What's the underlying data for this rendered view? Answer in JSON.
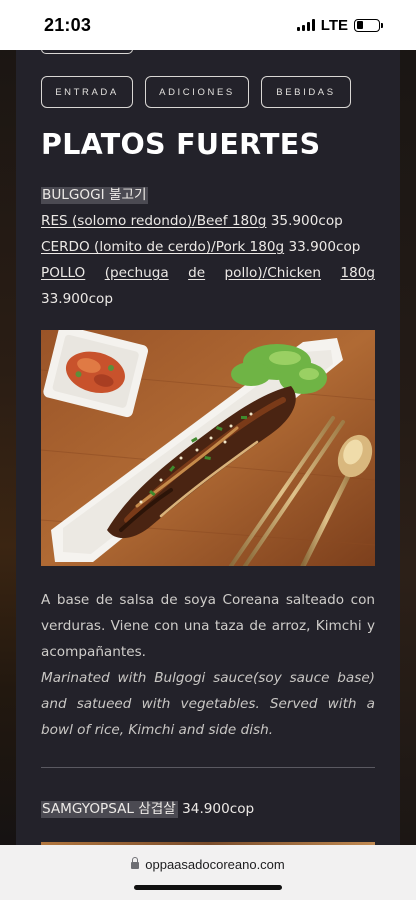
{
  "status_bar": {
    "time": "21:03",
    "network": "LTE",
    "battery_level": 0.3,
    "icons": [
      "signal-icon",
      "battery-icon"
    ]
  },
  "tabs": [
    {
      "label": "ENTRADA"
    },
    {
      "label": "ADICIONES"
    },
    {
      "label": "BEBIDAS"
    }
  ],
  "section": {
    "title": "PLATOS FUERTES"
  },
  "dish": {
    "name": "BULGOGI 불고기",
    "options": [
      {
        "label": "RES (solomo redondo)/Beef 180g",
        "price": "35.900cop"
      },
      {
        "label": "CERDO (lomito de cerdo)/Pork 180g",
        "price": "33.900cop"
      },
      {
        "label_parts": [
          "POLLO",
          "(pechuga",
          "de",
          "pollo)/Chicken",
          "180g"
        ],
        "price": "33.900cop"
      }
    ],
    "description_es": "A base de salsa de soya Coreana salteado con verduras. Viene con una taza de arroz, Kimchi y acompañantes.",
    "description_en": "Marinated with Bulgogi sauce(soy sauce base) and satueed with vegetables. Served with a bowl of rice, Kimchi and side dish."
  },
  "next_dish": {
    "name": "SAMGYOPSAL 삼겹살",
    "price": "34.900cop"
  },
  "browser": {
    "url": "oppaasadocoreano.com",
    "icons": [
      "lock-icon"
    ]
  },
  "colors": {
    "panel": "#23222a",
    "name_highlight": "#4b4a52",
    "text": "#ece9e6"
  }
}
